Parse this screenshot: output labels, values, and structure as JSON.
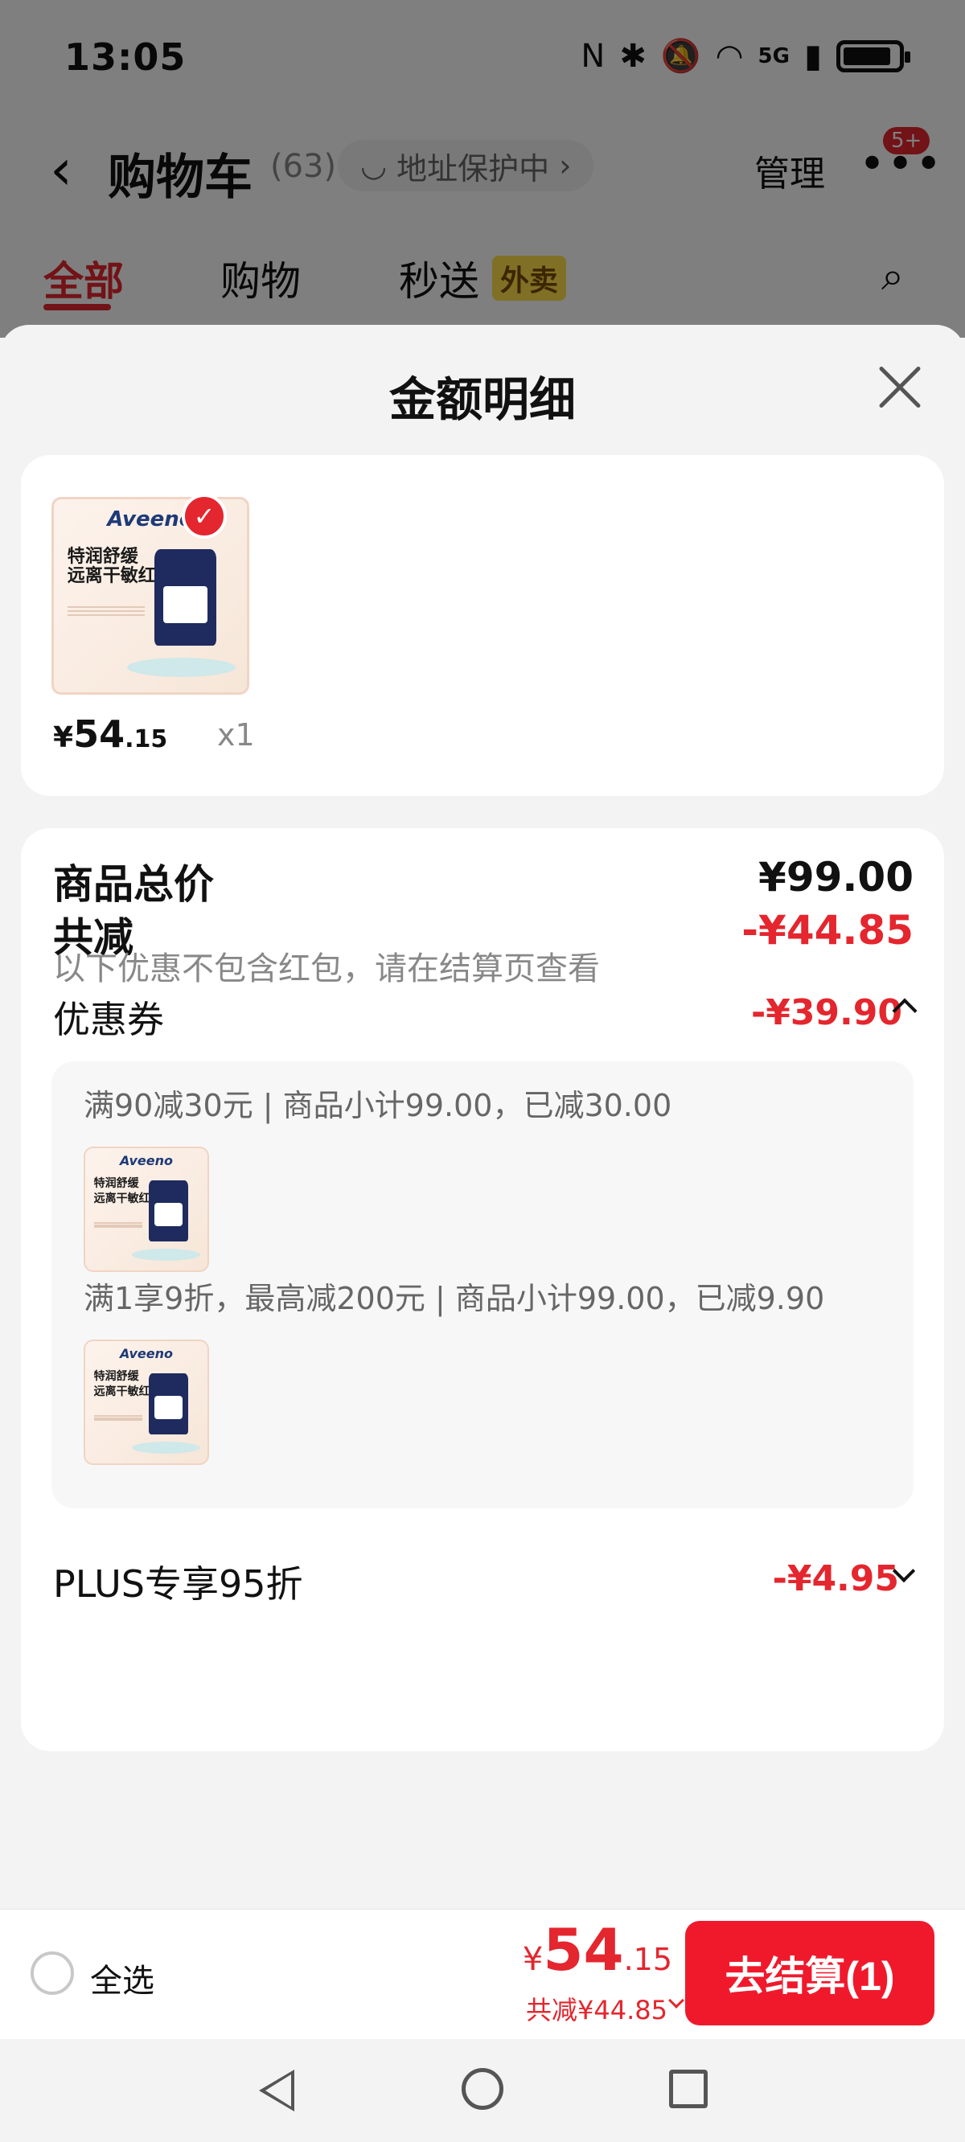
{
  "status_bar": {
    "time": "13:05",
    "network": "5G"
  },
  "cart_header": {
    "back_icon": "chevron-left-icon",
    "title": "购物车",
    "count": "(63)",
    "address_pill": "地址保护中",
    "manage": "管理",
    "badge": "5+"
  },
  "cart_tabs": {
    "tabs": [
      {
        "label": "全部",
        "active": true
      },
      {
        "label": "购物",
        "active": false
      },
      {
        "label": "秒送",
        "active": false
      }
    ],
    "waimai_tag": "外卖"
  },
  "sheet": {
    "title": "金额明细",
    "product": {
      "brand": "Aveeno",
      "promo_line1": "特润舒缓",
      "promo_line2": "远离干敏红",
      "price_yen": "¥",
      "price_int": "54",
      "price_dec": ".15",
      "quantity": "x1"
    },
    "detail": {
      "total_label": "商品总价",
      "total_value": "¥99.00",
      "discount_label": "共减",
      "discount_value": "-¥44.85",
      "note": "以下优惠不包含红包，请在结算页查看",
      "coupon_label": "优惠券",
      "coupon_value": "-¥39.90",
      "coupons": [
        {
          "desc": "满90减30元 | 商品小计99.00，已减30.00"
        },
        {
          "desc": "满1享9折，最高减200元 | 商品小计99.00，已减9.90"
        }
      ],
      "plus_label": "PLUS专享95折",
      "plus_value": "-¥4.95"
    }
  },
  "checkout": {
    "select_all": "全选",
    "total_yen": "¥",
    "total_int": "54",
    "total_dec": ".15",
    "saved": "共减¥44.85",
    "button": "去结算(1)"
  },
  "colors": {
    "accent": "#e4262e",
    "checkout_button": "#f0192c",
    "waimai_tag": "#ffe14a"
  }
}
